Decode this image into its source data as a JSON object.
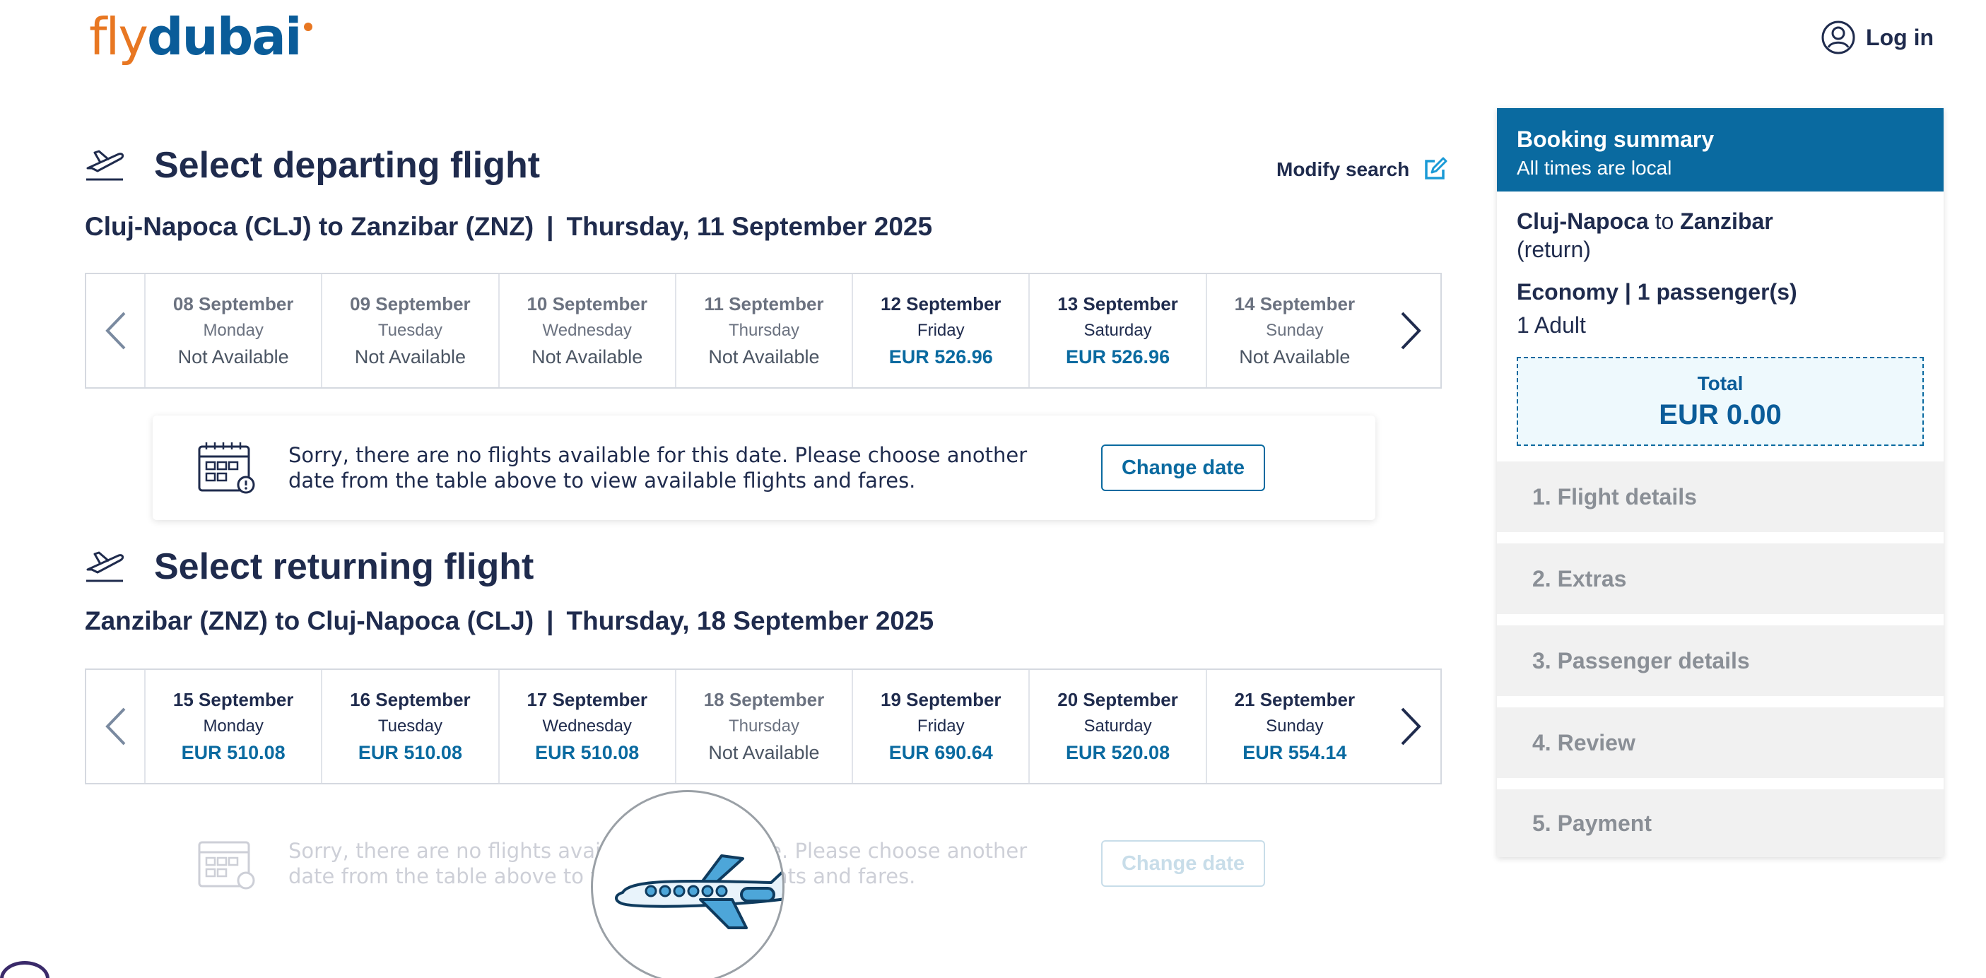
{
  "header": {
    "logo_fly": "fly",
    "logo_dubai": "dubai",
    "login_label": "Log in"
  },
  "departing": {
    "title": "Select departing flight",
    "modify_label": "Modify search",
    "route": "Cluj-Napoca (CLJ) to Zanzibar (ZNZ)",
    "separator": "|",
    "date": "Thursday, 11 September 2025",
    "days": [
      {
        "date": "08 September",
        "weekday": "Monday",
        "price": "Not Available"
      },
      {
        "date": "09 September",
        "weekday": "Tuesday",
        "price": "Not Available"
      },
      {
        "date": "10 September",
        "weekday": "Wednesday",
        "price": "Not Available"
      },
      {
        "date": "11 September",
        "weekday": "Thursday",
        "price": "Not Available"
      },
      {
        "date": "12 September",
        "weekday": "Friday",
        "price": "EUR 526.96"
      },
      {
        "date": "13 September",
        "weekday": "Saturday",
        "price": "EUR 526.96"
      },
      {
        "date": "14 September",
        "weekday": "Sunday",
        "price": "Not Available"
      }
    ],
    "notice": "Sorry, there are no flights available for this date. Please choose another date from the table above to view available flights and fares.",
    "change_label": "Change date"
  },
  "returning": {
    "title": "Select returning flight",
    "route": "Zanzibar (ZNZ) to Cluj-Napoca (CLJ)",
    "separator": "|",
    "date": "Thursday, 18 September 2025",
    "days": [
      {
        "date": "15 September",
        "weekday": "Monday",
        "price": "EUR 510.08"
      },
      {
        "date": "16 September",
        "weekday": "Tuesday",
        "price": "EUR 510.08"
      },
      {
        "date": "17 September",
        "weekday": "Wednesday",
        "price": "EUR 510.08"
      },
      {
        "date": "18 September",
        "weekday": "Thursday",
        "price": "Not Available"
      },
      {
        "date": "19 September",
        "weekday": "Friday",
        "price": "EUR 690.64"
      },
      {
        "date": "20 September",
        "weekday": "Saturday",
        "price": "EUR 520.08"
      },
      {
        "date": "21 September",
        "weekday": "Sunday",
        "price": "EUR 554.14"
      }
    ],
    "notice": "Sorry, there are no flights available for this date. Please choose another date from the table above to view available flights and fares.",
    "change_label": "Change date"
  },
  "summary": {
    "title": "Booking summary",
    "subtitle": "All times are local",
    "from": "Cluj-Napoca",
    "to_word": "to",
    "to": "Zanzibar",
    "trip_type": "(return)",
    "cabin": "Economy | 1 passenger(s)",
    "pax": "1 Adult",
    "total_label": "Total",
    "total_value": "EUR 0.00",
    "steps": [
      "1. Flight details",
      "2. Extras",
      "3. Passenger details",
      "4. Review",
      "5. Payment"
    ]
  },
  "colors": {
    "brand_blue": "#0a6aa0",
    "brand_orange": "#e87722",
    "navy_text": "#1f2b4d"
  }
}
